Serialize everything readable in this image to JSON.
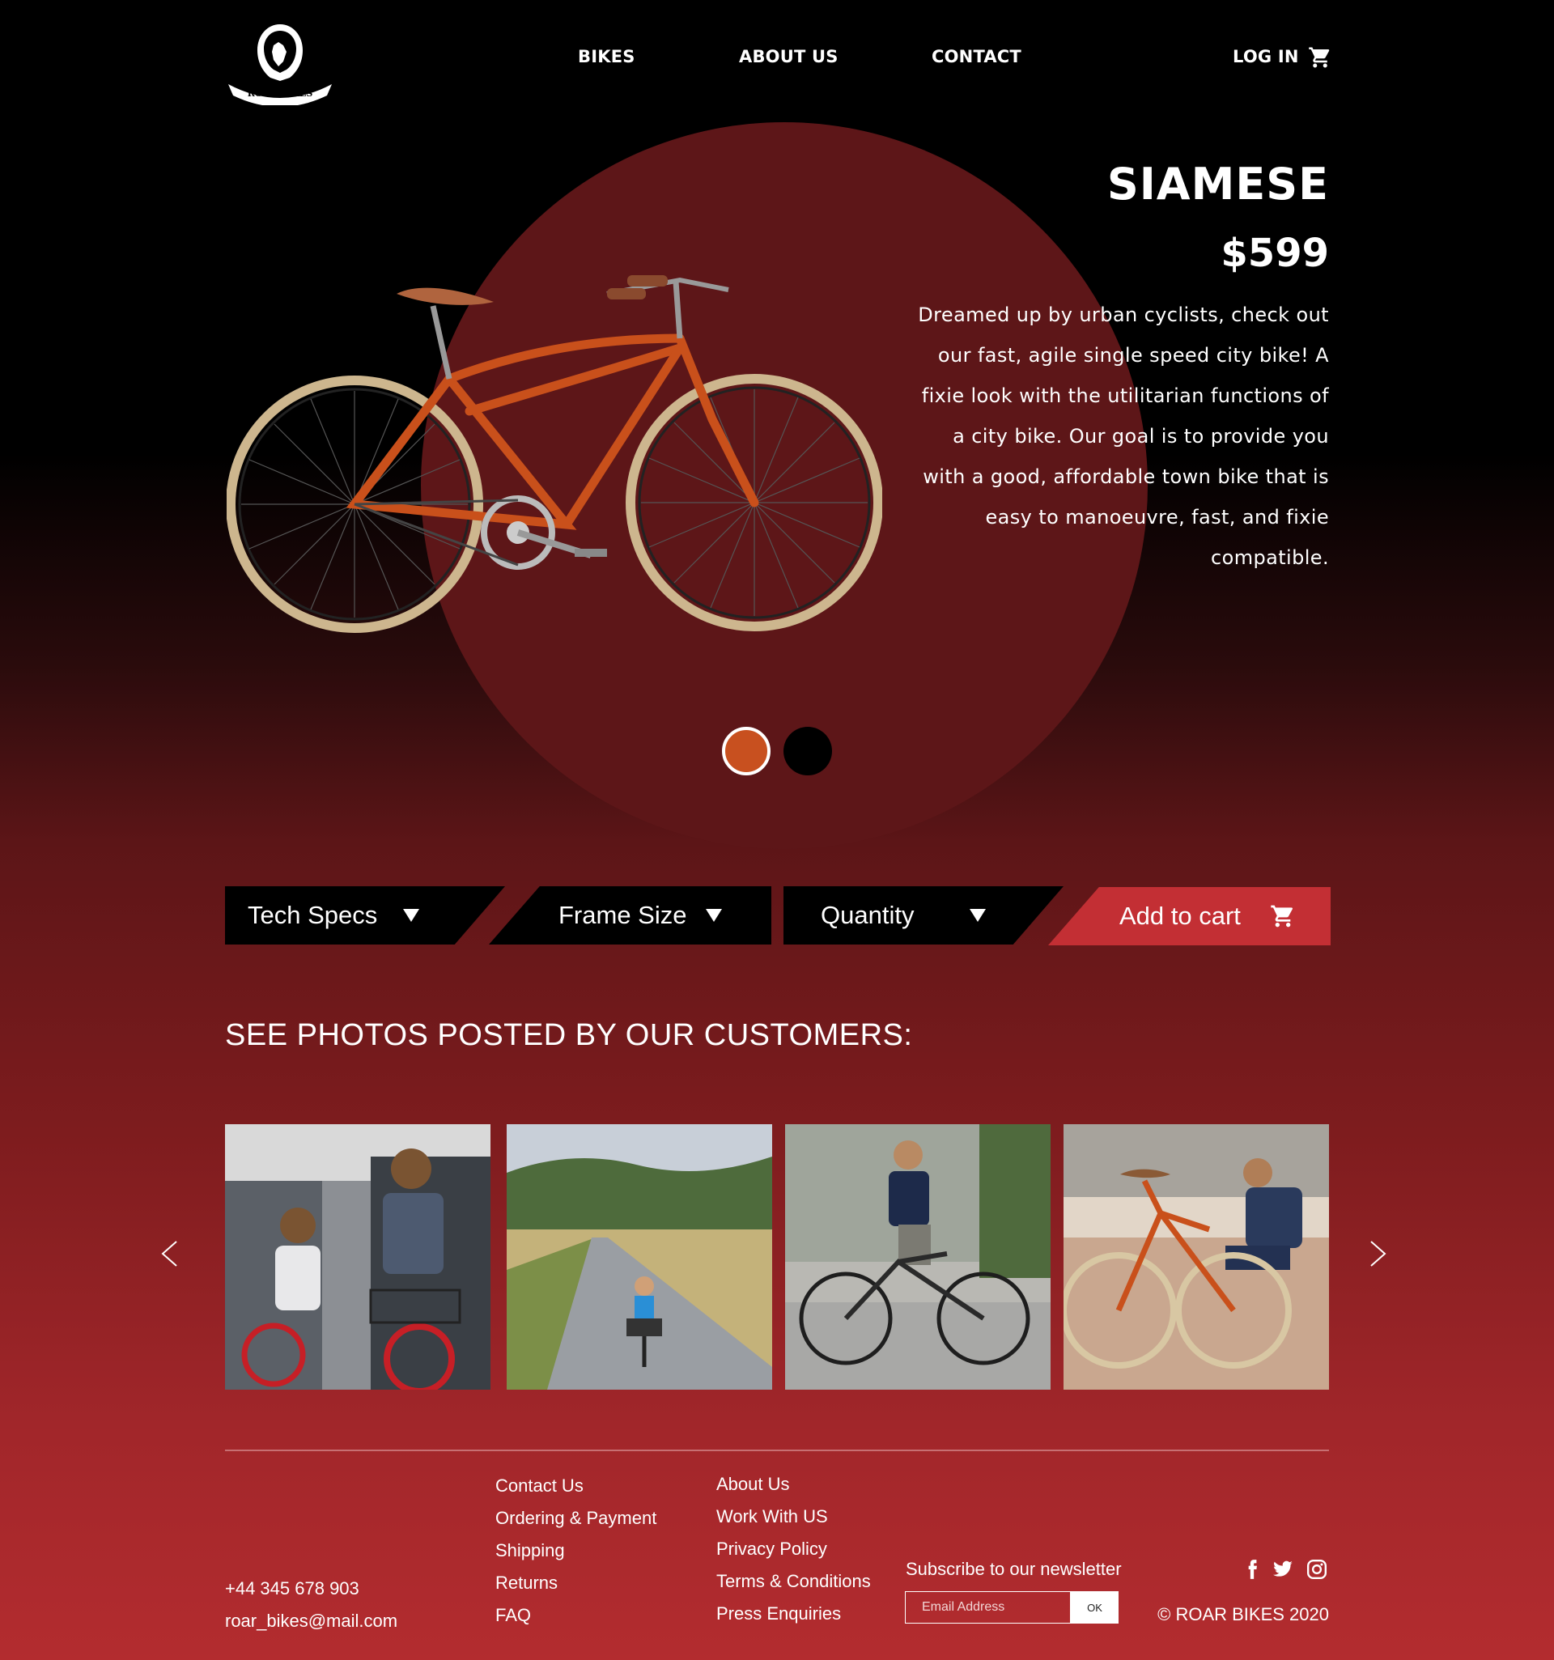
{
  "header": {
    "logo_text": "ROAR BIKES",
    "nav": [
      "BIKES",
      "ABOUT US",
      "CONTACT"
    ],
    "login": "LOG IN",
    "cart_icon": "cart-icon"
  },
  "product": {
    "name": "SIAMESE",
    "price": "$599",
    "description": "Dreamed up by urban cyclists, check out our fast, agile single speed city bike! A fixie look with the utilitarian functions of a city bike. Our goal is to provide you with a good, affordable town bike that is easy to manoeuvre, fast, and fixie compatible.",
    "colors": [
      "#c8501f",
      "#000000"
    ],
    "selected_color": "#c8501f"
  },
  "options": {
    "tech_specs": "Tech Specs",
    "frame_size": "Frame Size",
    "quantity": "Quantity",
    "add_to_cart": "Add to cart"
  },
  "gallery": {
    "title": "SEE PHOTOS POSTED BY OUR CUSTOMERS:"
  },
  "footer": {
    "phone": "+44 345 678 903",
    "email": "roar_bikes@mail.com",
    "col1": [
      "Contact Us",
      "Ordering & Payment",
      "Shipping",
      "Returns",
      "FAQ"
    ],
    "col2": [
      "About Us",
      "Work With US",
      "Privacy Policy",
      "Terms & Conditions",
      "Press Enquiries"
    ],
    "newsletter_label": "Subscribe to our newsletter",
    "email_placeholder": "Email Address",
    "ok": "OK",
    "copyright": "© ROAR BIKES 2020",
    "social": [
      "facebook-icon",
      "twitter-icon",
      "instagram-icon"
    ]
  },
  "colors": {
    "accent": "#c32f34",
    "circle": "#5d1618"
  }
}
